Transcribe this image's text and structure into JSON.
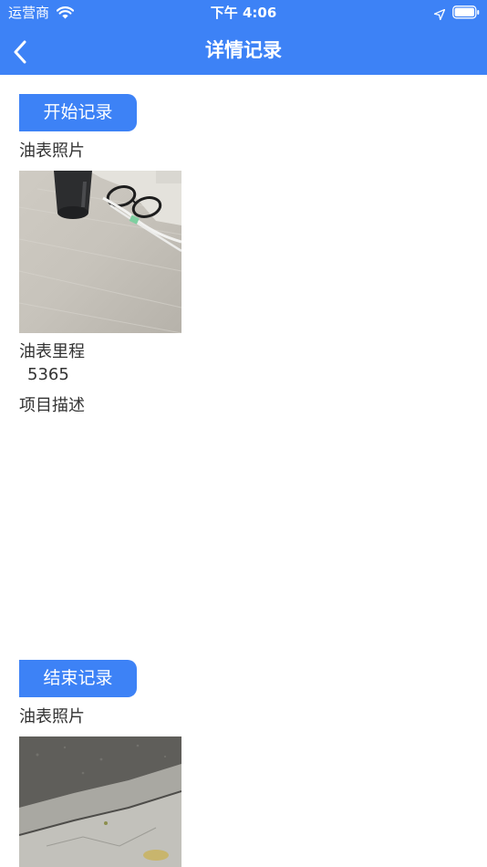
{
  "status_bar": {
    "carrier": "运营商",
    "time": "下午 4:06"
  },
  "nav": {
    "title": "详情记录"
  },
  "start_section": {
    "button_label": "开始记录",
    "photo_label": "油表照片",
    "mileage_label": "油表里程",
    "mileage_value": "5365",
    "description_label": "项目描述"
  },
  "end_section": {
    "button_label": "结束记录",
    "photo_label": "油表照片"
  },
  "icons": {
    "back": "chevron-left-icon",
    "wifi": "wifi-icon",
    "location": "location-arrow-icon",
    "battery": "battery-icon"
  },
  "colors": {
    "primary": "#3d82f6",
    "text": "#333333",
    "background": "#ffffff"
  }
}
